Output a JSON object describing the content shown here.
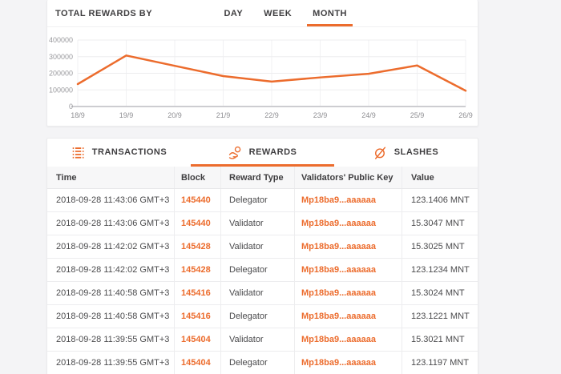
{
  "accent_color": "#EC6C2D",
  "chart_card": {
    "title": "TOTAL REWARDS BY",
    "tabs": [
      {
        "label": "DAY",
        "active": false
      },
      {
        "label": "WEEK",
        "active": false
      },
      {
        "label": "MONTH",
        "active": true
      }
    ]
  },
  "chart_data": {
    "type": "line",
    "x": [
      "18/9",
      "19/9",
      "20/9",
      "21/9",
      "22/9",
      "23/9",
      "24/9",
      "25/9",
      "26/9"
    ],
    "series": [
      {
        "name": "total-rewards",
        "values": [
          135000,
          307000,
          245000,
          183000,
          150000,
          175000,
          197000,
          247000,
          95000
        ]
      }
    ],
    "ylim": [
      0,
      400000
    ],
    "yticks": [
      0,
      100000,
      200000,
      300000,
      400000
    ],
    "grid": true,
    "legend_position": "none",
    "line_color": "#EC6C2D",
    "tick_color": "#98989c"
  },
  "table_card": {
    "tabs": [
      {
        "label": "TRANSACTIONS",
        "icon": "transactions-icon",
        "active": false
      },
      {
        "label": "REWARDS",
        "icon": "rewards-icon",
        "active": true
      },
      {
        "label": "SLASHES",
        "icon": "slashes-icon",
        "active": false
      }
    ],
    "columns": [
      "Time",
      "Block",
      "Reward Type",
      "Validators' Public Key",
      "Value"
    ],
    "rows": [
      {
        "time": "2018-09-28 11:43:06 GMT+3",
        "block": "145440",
        "reward_type": "Delegator",
        "public_key": "Mp18ba9...aaaaaa",
        "value": "123.1406 MNT"
      },
      {
        "time": "2018-09-28 11:43:06 GMT+3",
        "block": "145440",
        "reward_type": "Validator",
        "public_key": "Mp18ba9...aaaaaa",
        "value": "15.3047 MNT"
      },
      {
        "time": "2018-09-28 11:42:02 GMT+3",
        "block": "145428",
        "reward_type": "Validator",
        "public_key": "Mp18ba9...aaaaaa",
        "value": "15.3025 MNT"
      },
      {
        "time": "2018-09-28 11:42:02 GMT+3",
        "block": "145428",
        "reward_type": "Delegator",
        "public_key": "Mp18ba9...aaaaaa",
        "value": "123.1234 MNT"
      },
      {
        "time": "2018-09-28 11:40:58 GMT+3",
        "block": "145416",
        "reward_type": "Validator",
        "public_key": "Mp18ba9...aaaaaa",
        "value": "15.3024 MNT"
      },
      {
        "time": "2018-09-28 11:40:58 GMT+3",
        "block": "145416",
        "reward_type": "Delegator",
        "public_key": "Mp18ba9...aaaaaa",
        "value": "123.1221 MNT"
      },
      {
        "time": "2018-09-28 11:39:55 GMT+3",
        "block": "145404",
        "reward_type": "Validator",
        "public_key": "Mp18ba9...aaaaaa",
        "value": "15.3021 MNT"
      },
      {
        "time": "2018-09-28 11:39:55 GMT+3",
        "block": "145404",
        "reward_type": "Delegator",
        "public_key": "Mp18ba9...aaaaaa",
        "value": "123.1197 MNT"
      }
    ]
  }
}
